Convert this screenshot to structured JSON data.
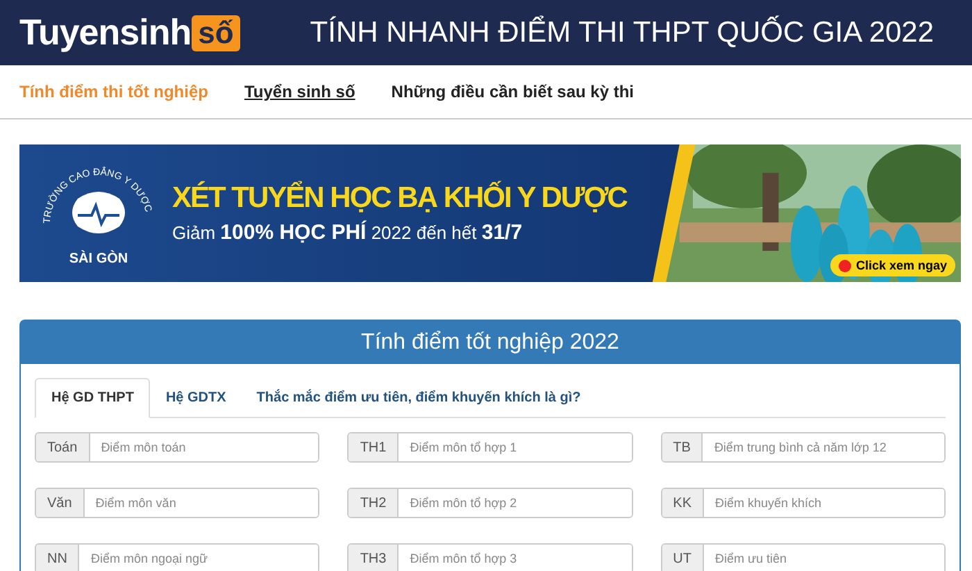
{
  "header": {
    "logo_main": "Tuyensinh",
    "logo_badge": "số",
    "title": "TÍNH NHANH ĐIỂM THI THPT QUỐC GIA 2022"
  },
  "nav": [
    {
      "label": "Tính điểm thi tốt nghiệp",
      "selected": true,
      "underlined": false
    },
    {
      "label": "Tuyển sinh số",
      "selected": false,
      "underlined": true
    },
    {
      "label": "Những điều cần biết sau kỳ thi",
      "selected": false,
      "underlined": false
    }
  ],
  "banner": {
    "logo_arc": "TRƯỜNG CAO ĐẲNG Y DƯỢC",
    "logo_city": "SÀI GÒN",
    "headline": "XÉT TUYỂN HỌC BẠ KHỐI Y DƯỢC",
    "subline": "Giảm **100% HỌC PHÍ** 2022 đến hết **31/7**",
    "button": "Click xem ngay"
  },
  "panel": {
    "title": "Tính điểm tốt nghiệp 2022",
    "tabs": [
      {
        "label": "Hệ GD THPT",
        "selected": true
      },
      {
        "label": "Hệ GDTX",
        "selected": false
      },
      {
        "label": "Thắc mắc điểm ưu tiên, điểm khuyến khích là gì?",
        "selected": false
      }
    ],
    "fields": [
      {
        "label": "Toán",
        "placeholder": "Điểm môn toán"
      },
      {
        "label": "TH1",
        "placeholder": "Điểm môn tổ hợp 1"
      },
      {
        "label": "TB",
        "placeholder": "Điểm trung bình cả năm lớp 12"
      },
      {
        "label": "Văn",
        "placeholder": "Điểm môn văn"
      },
      {
        "label": "TH2",
        "placeholder": "Điểm môn tổ hợp 2"
      },
      {
        "label": "KK",
        "placeholder": "Điểm khuyến khích"
      },
      {
        "label": "NN",
        "placeholder": "Điểm môn ngoại ngữ"
      },
      {
        "label": "TH3",
        "placeholder": "Điểm môn tổ hợp 3"
      },
      {
        "label": "UT",
        "placeholder": "Điểm ưu tiên"
      }
    ]
  }
}
